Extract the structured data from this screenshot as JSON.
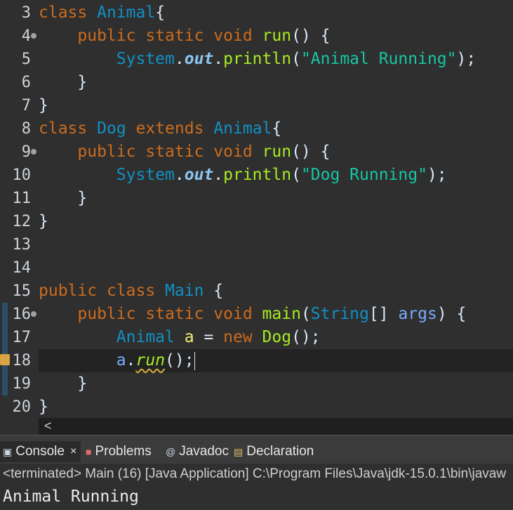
{
  "editor": {
    "line_numbers": [
      "3",
      "4",
      "5",
      "6",
      "7",
      "8",
      "9",
      "10",
      "11",
      "12",
      "13",
      "14",
      "15",
      "16",
      "17",
      "18",
      "19",
      "20"
    ],
    "tokens": {
      "class_kw": "class",
      "public": "public",
      "static": "static",
      "void": "void",
      "extends": "extends",
      "new": "new",
      "animal": "Animal",
      "dog": "Dog",
      "main_cls": "Main",
      "run": "run",
      "main_fn": "main",
      "system": "System",
      "out": "out",
      "println": "println",
      "str_animal": "\"Animal Running\"",
      "str_dog": "\"Dog Running\"",
      "string_type": "String",
      "args": "args",
      "var_a": "a",
      "call_run": "run",
      "dog_ctor": "Dog"
    }
  },
  "scrollbar": {
    "left_arrow": "<"
  },
  "tabs": [
    {
      "label": "Console",
      "icon": "console-icon",
      "close": "×"
    },
    {
      "label": "Problems",
      "icon": "problems-icon"
    },
    {
      "label": "Javadoc",
      "icon": "javadoc-icon"
    },
    {
      "label": "Declaration",
      "icon": "declaration-icon"
    }
  ],
  "console": {
    "status": "<terminated> Main (16) [Java Application] C:\\Program Files\\Java\\jdk-15.0.1\\bin\\javaw",
    "output": "Animal Running"
  },
  "colors": {
    "background": "#2f2f2f",
    "keyword": "#cc6c1d",
    "class": "#1290c3",
    "method": "#a7ec21",
    "string": "#17c6a3"
  }
}
